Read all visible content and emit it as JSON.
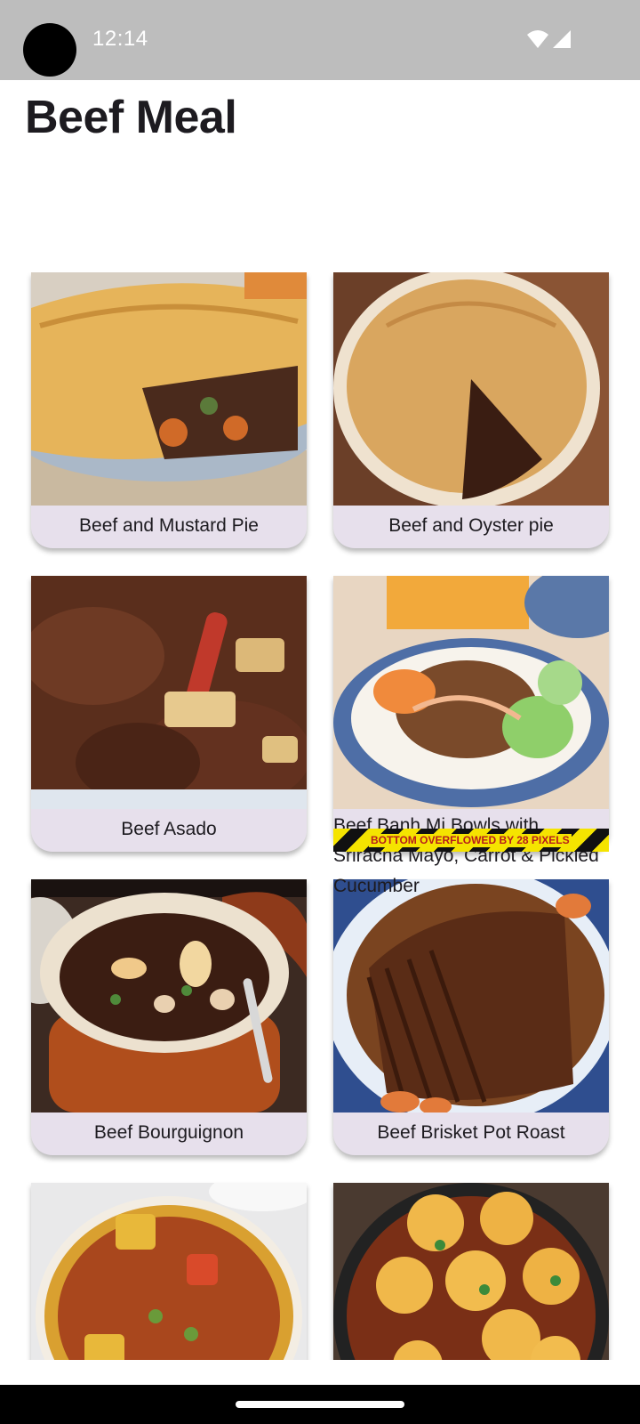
{
  "status_bar": {
    "time": "12:14",
    "icons": [
      "wifi-icon",
      "cellular-signal-icon"
    ]
  },
  "page": {
    "title": "Beef Meal"
  },
  "meals": [
    {
      "label": "Beef and Mustard Pie",
      "image": "pie-with-carrots"
    },
    {
      "label": "Beef and Oyster pie",
      "image": "pie-with-slice-cut"
    },
    {
      "label": "Beef Asado",
      "image": "braised-beef-slices"
    },
    {
      "label": "Beef Banh Mi Bowls with Sriracha Mayo, Carrot & Pickled Cucumber",
      "image": "rice-bowl-with-vegetables"
    },
    {
      "label": "Beef Bourguignon",
      "image": "stew-in-casserole"
    },
    {
      "label": "Beef Brisket Pot Roast",
      "image": "sliced-brisket"
    },
    {
      "label": "",
      "image": "curry-stew-bowl"
    },
    {
      "label": "",
      "image": "stew-with-dumplings"
    }
  ],
  "overflow_warning": {
    "text": "BOTTOM OVERFLOWED BY 28 PIXELS"
  },
  "colors": {
    "status_bar": "#bdbdbd",
    "card_label_bg": "#e7e0ec",
    "title_text": "#1d1b20",
    "warning_text": "#b71c1c",
    "warning_stripe": "#f5e400"
  }
}
